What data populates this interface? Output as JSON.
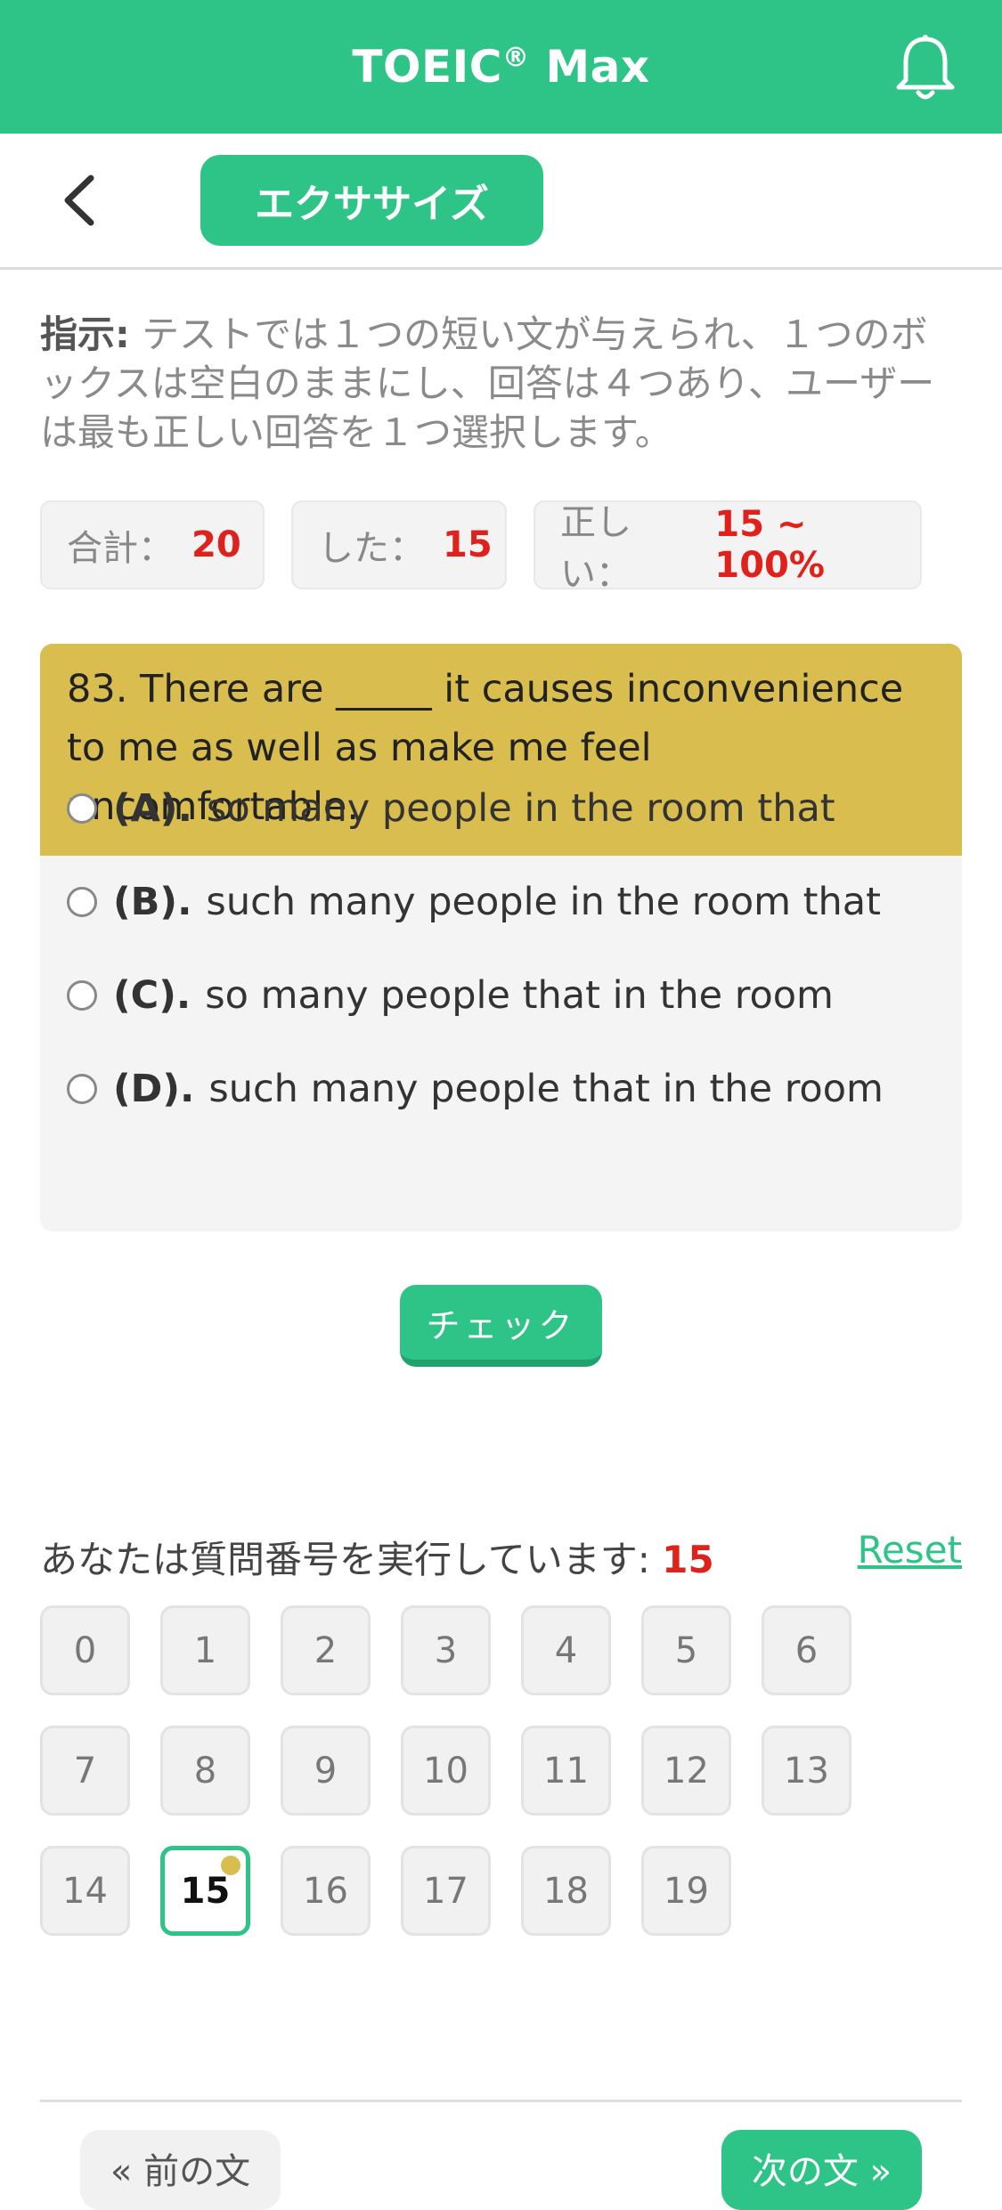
{
  "appbar": {
    "title": "TOEIC",
    "title_mark": "®",
    "title_suffix": " Max",
    "bell_icon": "bell-icon"
  },
  "subbar": {
    "back_icon": "chevron-left-icon",
    "tab_label": "エクササイズ"
  },
  "instruction": {
    "label": "指示:",
    "text": " テストでは１つの短い文が与えられ、１つのボックスは空白のままにし、回答は４つあり、ユーザーは最も正しい回答を１つ選択します。"
  },
  "stats": [
    {
      "label": "合計：",
      "value": "20"
    },
    {
      "label": "した：",
      "value": "15"
    },
    {
      "label": "正しい：",
      "value": "15 ~ 100%"
    }
  ],
  "question": {
    "text": "83. There are _____ it causes inconvenience to me as well as make me feel uncomfortable.",
    "options": [
      {
        "key": "(A).",
        "text": "so many people in the room that"
      },
      {
        "key": "(B).",
        "text": "such many people in the room that"
      },
      {
        "key": "(C).",
        "text": "so many people that in the room"
      },
      {
        "key": "(D).",
        "text": "such many people that in the room"
      }
    ]
  },
  "check_button": "チェック",
  "progress": {
    "label": "あなたは質問番号を実行しています: ",
    "current": "15",
    "reset_label": "Reset",
    "numbers": [
      "0",
      "1",
      "2",
      "3",
      "4",
      "5",
      "6",
      "7",
      "8",
      "9",
      "10",
      "11",
      "12",
      "13",
      "14",
      "15",
      "16",
      "17",
      "18",
      "19"
    ]
  },
  "nav": {
    "prev_label": "« 前の文",
    "next_label": "次の文 »"
  },
  "colors": {
    "primary": "#2ec387",
    "accent": "#d9be4f",
    "highlight": "#e0201a"
  }
}
